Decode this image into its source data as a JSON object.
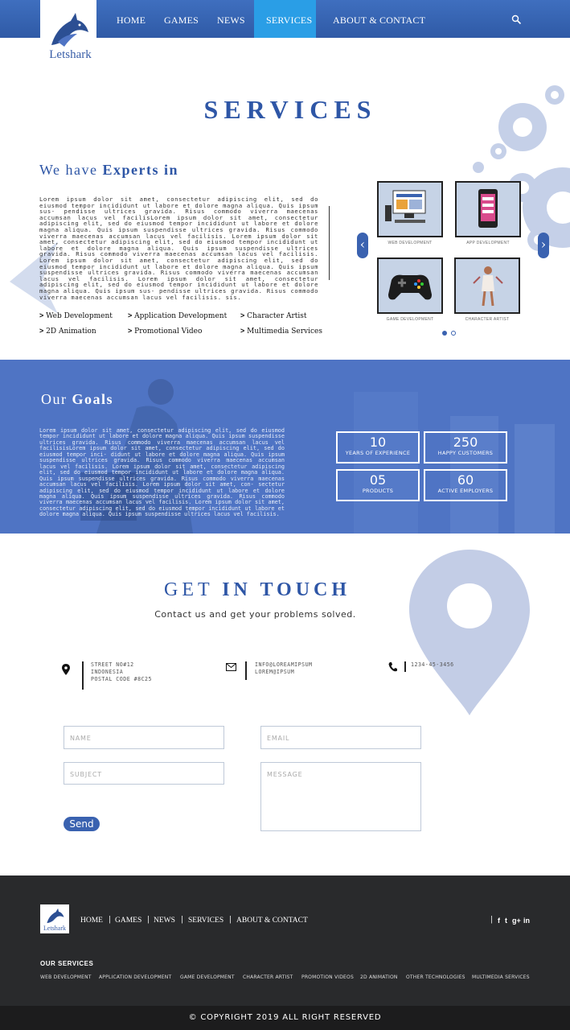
{
  "brand": {
    "name": "Letshark"
  },
  "nav": {
    "items": [
      {
        "label": "HOME"
      },
      {
        "label": "GAMES"
      },
      {
        "label": "NEWS"
      },
      {
        "label": "SERVICES"
      },
      {
        "label": "ABOUT & CONTACT"
      }
    ],
    "active": "SERVICES"
  },
  "services": {
    "title": "SERVICES",
    "heading_light": "We have ",
    "heading_bold": "Experts in",
    "body": "Lorem ipsum dolor sit amet, consectetur adipiscing elit, sed do eiusmod tempor incididunt ut labore et dolore magna aliqua. Quis ipsum sus- pendisse ultrices gravida. Risus commodo viverra maecenas accumsan lacus vel facilisLorem ipsum dolor sit amet, consectetur adipiscing elit, sed do eiusmod tempor incididunt ut labore et dolore magna aliqua. Quis ipsum suspendisse ultrices gravida. Risus commodo viverra maecenas accumsan lacus vel facilisis. Lorem ipsum dolor sit amet, consectetur adipiscing elit, sed do eiusmod tempor incididunt ut labore et dolore magna aliqua. Quis ipsum suspendisse ultrices gravida. Risus commodo viverra maecenas accumsan lacus vel facilisis. Lorem ipsum dolor sit amet, consectetur adipiscing elit, sed do eiusmod tempor incididunt ut labore et dolore magna aliqua. Quis ipsum suspendisse ultrices gravida. Risus commodo viverra maecenas accumsan lacus vel facilisis. Lorem ipsum dolor sit amet, consectetur adipiscing elit, sed do eiusmod tempor incididunt ut labore et dolore magna aliqua. Quis ipsum sus- pendisse ultrices gravida. Risus commodo viverra maecenas accumsan lacus vel facilisis. sis.",
    "list": [
      "Web Development",
      "Application Development",
      "Character Artist",
      "2D Animation",
      "Promotional Video",
      "Multimedia Services"
    ],
    "carousel": [
      "WEB DEVELOPMENT",
      "APP DEVELOPMENT",
      "GAME DEVELOPMENT",
      "CHARACTER ARTIST"
    ],
    "carousel_page": 1,
    "carousel_pages": 2
  },
  "goals": {
    "heading_light": "Our ",
    "heading_bold": "Goals",
    "body": "Lorem ipsum dolor sit amet, consectetur adipiscing elit, sed do eiusmod tempor incididunt ut labore et dolore magna aliqua. Quis ipsum suspendisse ultrices gravida. Risus commodo viverra maecenas accumsan lacus vel facilisisLorem ipsum dolor sit amet, consectetur adipiscing elit, sed do eiusmod tempor inci- didunt ut labore et dolore magna aliqua. Quis ipsum suspendisse ultrices gravida. Risus commodo viverra maecenas accumsan lacus vel facilisis. Lorem ipsum dolor sit amet, consectetur adipiscing elit, sed do eiusmod tempor incididunt ut labore et dolore magna aliqua. Quis ipsum suspendisse ultrices gravida. Risus commodo viverra maecenas accumsan lacus vel facilisis. Lorem ipsum dolor sit amet, con- sectetur adipiscing elit, sed do eiusmod tempor incididunt ut labore et dolore magna aliqua. Quis ipsum suspendisse ultrices gravida. Risus commodo viverra maecenas accumsan lacus vel facilisis. Lorem ipsum dolor sit amet, consectetur adipiscing elit, sed do eiusmod tempor incididunt ut labore et dolore magna aliqua. Quis ipsum suspendisse ultrices lacus vel facilisis.",
    "stats": [
      {
        "value": "10",
        "label": "YEARS OF EXPERIENCE"
      },
      {
        "value": "250",
        "label": "HAPPY CUSTOMERS"
      },
      {
        "value": "05",
        "label": "PRODUCTS"
      },
      {
        "value": "60",
        "label": "ACTIVE EMPLOYERS"
      }
    ]
  },
  "contact": {
    "heading_light": "GET ",
    "heading_bold": "IN TOUCH",
    "subtitle": "Contact us and get your problems solved.",
    "address": [
      "STREET NO#12",
      "INDONESIA",
      "POSTAL CODE #8C25"
    ],
    "emails": [
      "INFO@LOREAMIPSUM",
      "LOREM@IPSUM"
    ],
    "phone": "1234-45-3456",
    "form": {
      "name_placeholder": "NAME",
      "email_placeholder": "EMAIL",
      "subject_placeholder": "SUBJECT",
      "message_placeholder": "MESSAGE",
      "send_label": "Send"
    }
  },
  "footer": {
    "links": [
      "HOME",
      "GAMES",
      "NEWS",
      "SERVICES",
      "ABOUT & CONTACT"
    ],
    "social": [
      "f",
      "t",
      "g+",
      "in"
    ],
    "services_heading": "OUR SERVICES",
    "services": [
      "WEB DEVELOPMENT",
      "APPLICATION DEVELOPMENT",
      "GAME DEVELOPMENT",
      "CHARACTER ARTIST",
      "PROMOTION VIDEOS",
      "2D ANIMATION",
      "OTHER TECHNOLOGIES",
      "MULTIMEDIA SERVICES"
    ],
    "copyright": "©   COPYRIGHT 2019 ALL RIGHT RESERVED"
  },
  "colors": {
    "primary": "#2e56a6",
    "nav": "#3f6fbf",
    "nav_active": "#2a9ee6",
    "goals_bg": "#4f74c4",
    "footer": "#292a2c",
    "accent_light": "#c3cde6"
  },
  "icons": [
    "search-icon",
    "gear-icon",
    "location-pin-icon",
    "envelope-icon",
    "phone-icon",
    "facebook-icon",
    "twitter-icon",
    "google-plus-icon",
    "linkedin-icon",
    "chevron-left-icon",
    "chevron-right-icon"
  ]
}
